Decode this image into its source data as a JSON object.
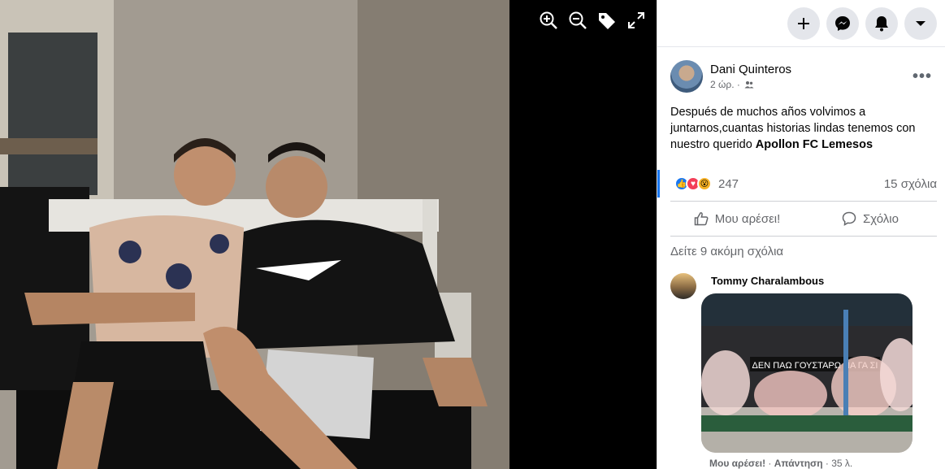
{
  "viewer": {
    "tools": [
      {
        "icon": "zoom-in-icon"
      },
      {
        "icon": "zoom-out-icon"
      },
      {
        "icon": "tag-icon"
      },
      {
        "icon": "fullscreen-icon"
      }
    ]
  },
  "topbar": {
    "buttons": [
      {
        "icon": "plus-icon"
      },
      {
        "icon": "messenger-icon"
      },
      {
        "icon": "bell-icon"
      },
      {
        "icon": "caret-down-icon"
      }
    ]
  },
  "post": {
    "author": "Dani Quinteros",
    "time": "2 ώρ. ·",
    "audience_icon": "friends-icon",
    "more_label": "•••",
    "text_before": "Después de muchos años volvimos a juntarnos,cuantas historias lindas tenemos con nuestro querido ",
    "mention": "Apollon FC Lemesos",
    "reaction_count": "247",
    "comment_count": "15 σχόλια",
    "like_label": "Μου αρέσει!",
    "comment_label": "Σχόλιο",
    "more_comments": "Δείτε 9 ακόμη σχόλια"
  },
  "comment": {
    "author": "Tommy Charalambous",
    "banner_text": "ΔΕΝ ΠΑΩ ΓΟΥΣΤΑΡΩ ΝΑ ΓΑ ΣΙ",
    "like_label": "Μου αρέσει!",
    "reply_label": "Απάντηση",
    "time": "35 λ."
  },
  "colors": {
    "accent": "#1877f2",
    "secondary_text": "#65676b",
    "button_bg": "#e4e6eb"
  }
}
